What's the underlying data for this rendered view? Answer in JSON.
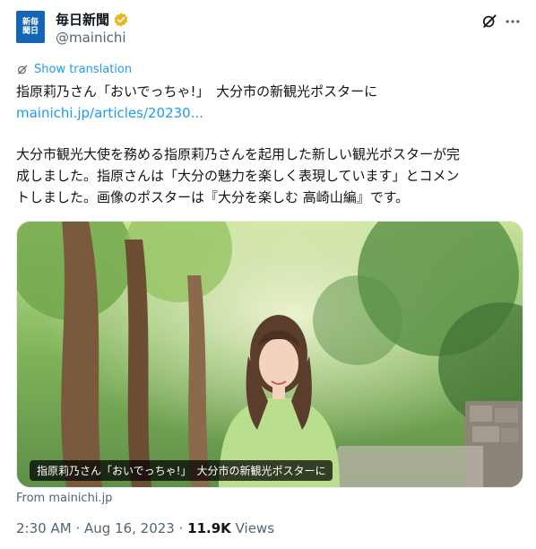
{
  "account": {
    "display_name": "毎日新聞",
    "handle": "@mainichi",
    "avatar_text": [
      "新毎",
      "聞日"
    ],
    "verified_color": "#e8b424"
  },
  "tweet": {
    "show_translation": "Show translation",
    "headline": "指原莉乃さん「おいでっちゃ!」　大分市の新観光ポスターに",
    "link": "mainichi.jp/articles/20230...",
    "body_lines": [
      "大分市観光大使を務める指原莉乃さんを起用した新しい観光ポスターが完",
      "成しました。指原さんは「大分の魅力を楽しく表現しています」とコメン",
      "トしました。画像のポスターは『大分を楽しむ 高崎山編』です。"
    ],
    "media_caption": "指原莉乃さん「おいでっちゃ!」　大分市の新観光ポスターに",
    "source": "From mainichi.jp",
    "time": "2:30 AM",
    "date": "Aug 16, 2023",
    "views_count": "11.9K",
    "views_label": "Views"
  },
  "icons": {
    "grok": "grok-icon",
    "more": "more-icon",
    "translate": "translate-icon",
    "verified": "verified-badge-icon"
  },
  "colors": {
    "link": "#1d9bf0",
    "secondary_text": "#536471",
    "primary_text": "#0f1419"
  }
}
